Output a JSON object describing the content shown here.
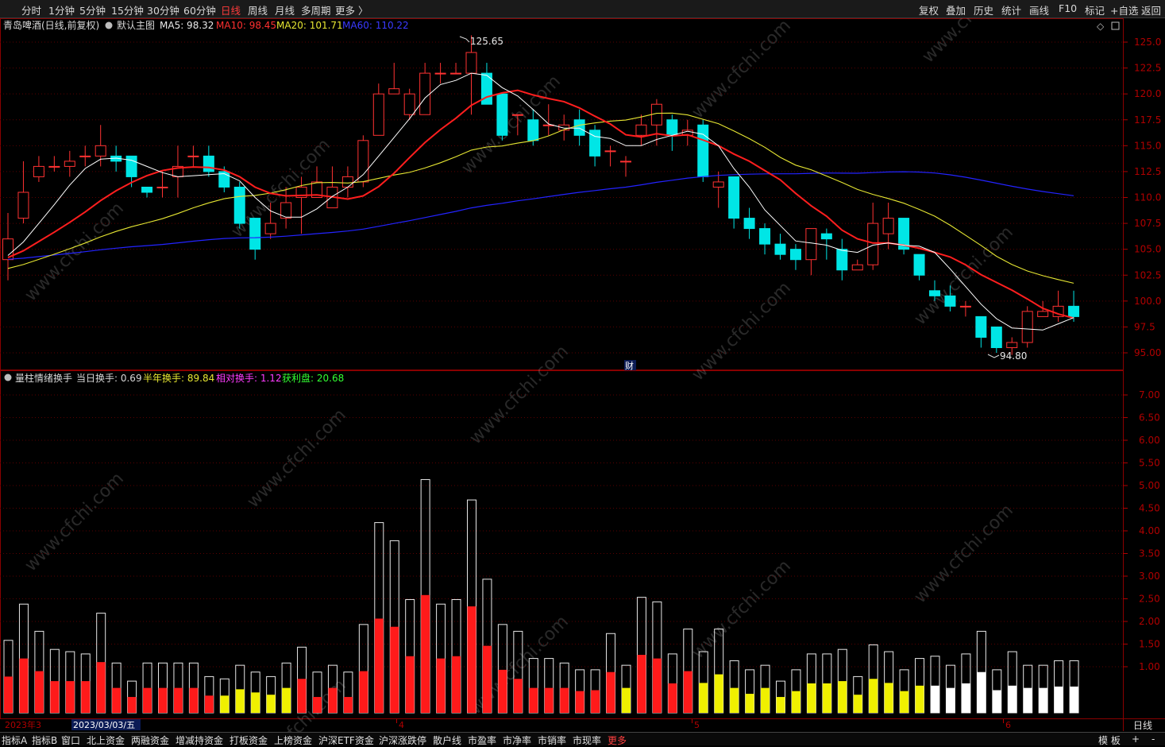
{
  "toolbar": {
    "periods": [
      "分时",
      "1分钟",
      "5分钟",
      "15分钟",
      "30分钟",
      "60分钟",
      "日线",
      "周线",
      "月线",
      "多周期",
      "更多 〉"
    ],
    "active_period": "日线",
    "right_buttons": [
      "复权",
      "叠加",
      "历史",
      "统计",
      "画线",
      "F10",
      "标记",
      "+自选",
      "返回"
    ]
  },
  "price_panel": {
    "stock_name": "青岛啤酒(日线,前复权)",
    "template": "默认主图",
    "ma5_label": "MA5: 98.32",
    "ma10_label": "MA10: 98.45",
    "ma20_label": "MA20: 101.71",
    "ma60_label": "MA60: 110.22",
    "high_marker": "125.65",
    "low_marker": "94.80",
    "fin_marker": "财",
    "y_ticks": [
      "125.0",
      "122.5",
      "120.0",
      "117.5",
      "115.0",
      "112.5",
      "110.0",
      "107.5",
      "105.0",
      "102.5",
      "100.0",
      "97.5",
      "95.00"
    ]
  },
  "indicator_panel": {
    "name": "量柱情绪换手",
    "daily_turnover": "当日换手: 0.69",
    "half_year": "半年换手: 89.84",
    "relative": "相对换手: 1.12",
    "profit": "获利盘: 20.68",
    "y_ticks": [
      "7.00",
      "6.50",
      "6.00",
      "5.50",
      "5.00",
      "4.50",
      "4.00",
      "3.50",
      "3.00",
      "2.50",
      "2.00",
      "1.50",
      "1.00"
    ]
  },
  "x_axis": {
    "labels": [
      "2023年3",
      "2023/03/03/五",
      "4",
      "5",
      "6"
    ],
    "period_label": "日线"
  },
  "bottom_tabs": [
    "指标A",
    "指标B",
    "窗口",
    "北上资金",
    "两融资金",
    "增减持资金",
    "打板资金",
    "上榜资金",
    "沪深ETF资金",
    "沪深涨跌停",
    "散户线",
    "市盈率",
    "市净率",
    "市销率",
    "市现率",
    "更多"
  ],
  "bottom_right": [
    "模 板",
    "+",
    "-"
  ],
  "colors": {
    "up": "#ff3232",
    "down": "#00e6e6",
    "ma5": "#ffffff",
    "ma10": "#ff2020",
    "ma20": "#e6e632",
    "ma60": "#2020ff",
    "grid": "#7a0000"
  },
  "watermark": "www.cfchi.com",
  "chart_data": {
    "type": "candlestick",
    "price_range": [
      94.8,
      125.65
    ],
    "candles": [
      [
        104.0,
        106.0,
        102.0,
        108.5
      ],
      [
        108.0,
        110.5,
        107.5,
        113.5
      ],
      [
        112.0,
        113.0,
        111.5,
        114.0
      ],
      [
        113.0,
        113.0,
        112.5,
        114.0
      ],
      [
        113.0,
        113.5,
        112.0,
        114.5
      ],
      [
        114.0,
        114.0,
        113.0,
        115.0
      ],
      [
        114.0,
        115.0,
        113.0,
        117.0
      ],
      [
        114.0,
        113.5,
        112.5,
        115.0
      ],
      [
        114.0,
        112.0,
        111.0,
        114.0
      ],
      [
        111.0,
        110.5,
        110.0,
        111.0
      ],
      [
        111.0,
        111.0,
        110.0,
        112.5
      ],
      [
        112.0,
        113.0,
        110.0,
        115.0
      ],
      [
        114.0,
        114.0,
        113.0,
        115.0
      ],
      [
        114.0,
        112.5,
        112.0,
        115.0
      ],
      [
        112.5,
        111.0,
        110.5,
        113.0
      ],
      [
        111.0,
        107.5,
        107.0,
        111.5
      ],
      [
        108.0,
        105.0,
        104.0,
        108.0
      ],
      [
        106.5,
        107.5,
        106.0,
        109.5
      ],
      [
        108.0,
        109.5,
        107.0,
        111.0
      ],
      [
        110.0,
        111.0,
        106.5,
        112.0
      ],
      [
        110.0,
        111.5,
        110.5,
        113.0
      ],
      [
        109.0,
        111.0,
        109.0,
        113.0
      ],
      [
        111.0,
        112.0,
        110.0,
        113.0
      ],
      [
        111.5,
        115.5,
        111.0,
        116.0
      ],
      [
        116.0,
        120.0,
        116.0,
        121.0
      ],
      [
        120.0,
        120.5,
        120.0,
        123.0
      ],
      [
        118.0,
        120.0,
        117.5,
        120.5
      ],
      [
        118.0,
        122.0,
        118.0,
        123.0
      ],
      [
        122.0,
        122.0,
        121.0,
        123.0
      ],
      [
        122.0,
        122.0,
        122.0,
        123.0
      ],
      [
        122.0,
        124.0,
        118.0,
        125.65
      ],
      [
        122.0,
        119.0,
        119.0,
        123.0
      ],
      [
        120.0,
        116.0,
        115.5,
        120.0
      ],
      [
        118.0,
        118.0,
        116.0,
        118.0
      ],
      [
        117.5,
        115.5,
        115.0,
        118.5
      ],
      [
        117.0,
        117.0,
        116.0,
        119.0
      ],
      [
        116.5,
        117.0,
        115.5,
        118.0
      ],
      [
        117.5,
        116.0,
        115.0,
        118.5
      ],
      [
        116.5,
        114.0,
        113.0,
        117.0
      ],
      [
        114.5,
        114.5,
        113.0,
        115.0
      ],
      [
        113.5,
        113.5,
        112.0,
        114.0
      ],
      [
        116.0,
        117.0,
        115.0,
        118.0
      ],
      [
        117.0,
        119.0,
        115.0,
        119.5
      ],
      [
        117.5,
        116.0,
        114.5,
        118.0
      ],
      [
        116.0,
        116.5,
        115.0,
        117.5
      ],
      [
        117.0,
        112.0,
        111.5,
        117.5
      ],
      [
        111.0,
        111.5,
        109.0,
        112.5
      ],
      [
        112.0,
        108.0,
        107.0,
        112.0
      ],
      [
        108.0,
        107.0,
        106.0,
        109.0
      ],
      [
        107.0,
        105.5,
        104.5,
        107.5
      ],
      [
        105.5,
        104.5,
        104.0,
        106.5
      ],
      [
        105.0,
        104.0,
        103.0,
        105.5
      ],
      [
        104.0,
        107.0,
        102.5,
        107.0
      ],
      [
        106.5,
        106.0,
        104.0,
        107.0
      ],
      [
        105.0,
        103.0,
        102.0,
        106.0
      ],
      [
        103.0,
        103.5,
        103.0,
        104.0
      ],
      [
        103.5,
        107.5,
        103.0,
        109.5
      ],
      [
        106.5,
        108.0,
        105.0,
        109.5
      ],
      [
        108.0,
        105.0,
        104.5,
        108.0
      ],
      [
        104.5,
        102.5,
        102.0,
        104.5
      ],
      [
        101.0,
        100.5,
        100.0,
        102.0
      ],
      [
        100.5,
        99.5,
        99.0,
        101.5
      ],
      [
        99.5,
        99.5,
        98.5,
        100.0
      ],
      [
        98.5,
        96.5,
        95.5,
        98.5
      ],
      [
        97.5,
        95.5,
        95.0,
        97.5
      ],
      [
        95.5,
        96.0,
        94.8,
        96.5
      ],
      [
        96.0,
        99.0,
        95.5,
        99.5
      ],
      [
        98.5,
        99.0,
        98.5,
        100.0
      ],
      [
        98.5,
        99.5,
        98.0,
        101.0
      ],
      [
        99.5,
        98.5,
        98.0,
        101.0
      ]
    ],
    "turnover_total": [
      1.6,
      2.4,
      1.8,
      1.4,
      1.35,
      1.3,
      2.2,
      1.1,
      0.7,
      1.1,
      1.1,
      1.1,
      1.1,
      0.8,
      0.75,
      1.05,
      0.9,
      0.8,
      1.1,
      1.45,
      0.9,
      1.05,
      0.9,
      1.95,
      4.2,
      3.8,
      2.5,
      5.15,
      2.4,
      2.5,
      4.7,
      2.95,
      1.95,
      1.8,
      1.2,
      1.2,
      1.1,
      0.95,
      0.95,
      1.75,
      1.05,
      2.55,
      2.45,
      1.3,
      1.85,
      1.35,
      1.85,
      1.15,
      0.95,
      1.05,
      0.7,
      0.95,
      1.3,
      1.3,
      1.4,
      0.8,
      1.5,
      1.35,
      0.95,
      1.2,
      1.25,
      1.05,
      1.3,
      1.8,
      0.95,
      1.35,
      1.05,
      1.05,
      1.15,
      1.15
    ],
    "turnover_filled": [
      0.8,
      1.2,
      0.92,
      0.7,
      0.7,
      0.7,
      1.12,
      0.55,
      0.35,
      0.55,
      0.55,
      0.55,
      0.55,
      0.38,
      0.38,
      0.52,
      0.45,
      0.4,
      0.55,
      0.75,
      0.35,
      0.55,
      0.35,
      0.92,
      2.08,
      1.9,
      1.25,
      2.6,
      1.2,
      1.25,
      2.35,
      1.48,
      0.95,
      0.75,
      0.55,
      0.55,
      0.55,
      0.48,
      0.5,
      0.9,
      0.55,
      1.28,
      1.2,
      0.65,
      0.92,
      0.66,
      0.85,
      0.55,
      0.42,
      0.55,
      0.35,
      0.48,
      0.65,
      0.65,
      0.7,
      0.4,
      0.75,
      0.66,
      0.48,
      0.6,
      0.6,
      0.55,
      0.65,
      0.9,
      0.5,
      0.6,
      0.55,
      0.55,
      0.58,
      0.58
    ],
    "turnover_color": [
      "r",
      "r",
      "r",
      "r",
      "r",
      "r",
      "r",
      "r",
      "r",
      "r",
      "r",
      "r",
      "r",
      "r",
      "y",
      "y",
      "y",
      "y",
      "y",
      "r",
      "r",
      "r",
      "r",
      "r",
      "r",
      "r",
      "r",
      "r",
      "r",
      "r",
      "r",
      "r",
      "r",
      "r",
      "r",
      "r",
      "r",
      "r",
      "r",
      "r",
      "y",
      "r",
      "r",
      "r",
      "r",
      "y",
      "y",
      "y",
      "y",
      "y",
      "y",
      "y",
      "y",
      "y",
      "y",
      "y",
      "y",
      "y",
      "y",
      "y",
      "w",
      "w",
      "w",
      "w",
      "w",
      "w",
      "w",
      "w",
      "w",
      "w"
    ]
  }
}
